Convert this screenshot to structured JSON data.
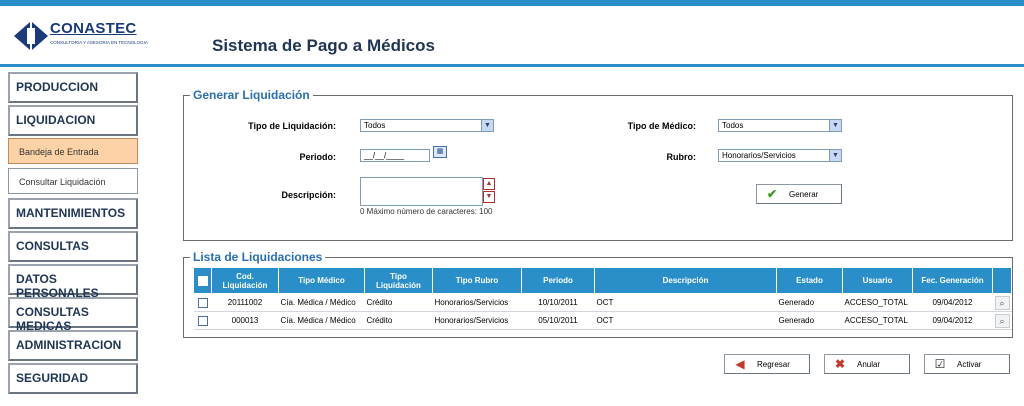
{
  "header": {
    "logo_text": "CONASTEC",
    "logo_sub": "CONSULTORIA Y ASESORIA EN TECNOLOGIA",
    "app_title": "Sistema de Pago a Médicos"
  },
  "sidebar": {
    "items": [
      {
        "label": "PRODUCCION"
      },
      {
        "label": "LIQUIDACION"
      },
      {
        "label": "Bandeja de Entrada"
      },
      {
        "label": "Consultar Liquidación"
      },
      {
        "label": "MANTENIMIENTOS"
      },
      {
        "label": "CONSULTAS"
      },
      {
        "label": "DATOS PERSONALES"
      },
      {
        "label": "CONSULTAS MEDICAS"
      },
      {
        "label": "ADMINISTRACION"
      },
      {
        "label": "SEGURIDAD"
      }
    ]
  },
  "generar": {
    "legend": "Generar Liquidación",
    "tipo_liq_label": "Tipo de Liquidación:",
    "tipo_liq_value": "Todos",
    "periodo_label": "Periodo:",
    "periodo_value": "__/__/____",
    "descripcion_label": "Descripción:",
    "descripcion_value": "",
    "descripcion_hint": "0 Máximo número de caracteres: 100",
    "tipo_medico_label": "Tipo de Médico:",
    "tipo_medico_value": "Todos",
    "rubro_label": "Rubro:",
    "rubro_value": "Honorarios/Servicios",
    "generar_btn": "Generar"
  },
  "lista": {
    "legend": "Lista de Liquidaciones",
    "columns": [
      "Cod. Liquidación",
      "Tipo Médico",
      "Tipo Liquidación",
      "Tipo Rubro",
      "Periodo",
      "Descripción",
      "Estado",
      "Usuario",
      "Fec. Generación"
    ],
    "rows": [
      [
        "20111002",
        "Cía. Médica / Médico",
        "Crédito",
        "Honorarios/Servicios",
        "10/10/2011",
        "OCT",
        "Generado",
        "ACCESO_TOTAL",
        "09/04/2012"
      ],
      [
        "000013",
        "Cía. Médica / Médico",
        "Crédito",
        "Honorarios/Servicios",
        "05/10/2011",
        "OCT",
        "Generado",
        "ACCESO_TOTAL",
        "09/04/2012"
      ]
    ]
  },
  "actions": {
    "regresar": "Regresar",
    "anular": "Anular",
    "activar": "Activar"
  },
  "colors": {
    "accent": "#2a8fc8",
    "title": "#1f3553",
    "active_sub": "#fcd2a6"
  }
}
